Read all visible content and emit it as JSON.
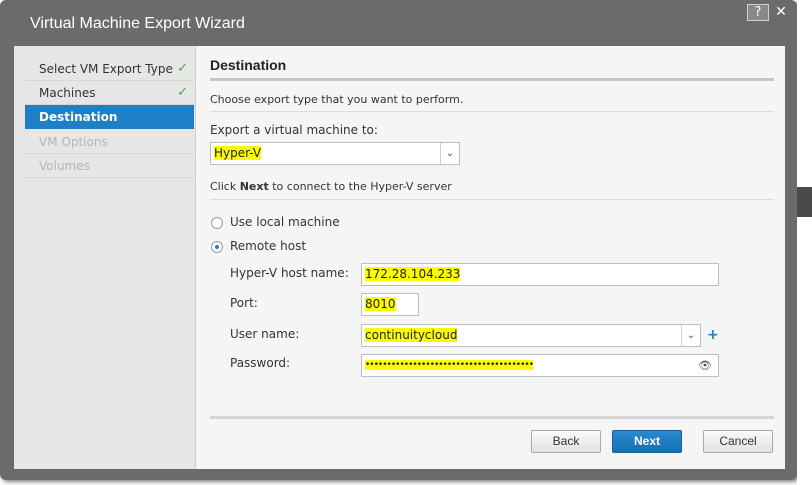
{
  "window": {
    "title": "Virtual Machine Export Wizard",
    "help_label": "?",
    "close_label": "✕"
  },
  "nav": {
    "items": [
      {
        "label": "Select VM Export Type",
        "state": "done"
      },
      {
        "label": "Machines",
        "state": "done"
      },
      {
        "label": "Destination",
        "state": "active"
      },
      {
        "label": "VM Options",
        "state": "disabled"
      },
      {
        "label": "Volumes",
        "state": "disabled"
      }
    ],
    "check_glyph": "✓"
  },
  "main": {
    "heading": "Destination",
    "instruction": "Choose export type that you want to perform.",
    "export_label": "Export a virtual machine to:",
    "export_value": "Hyper-V",
    "next_hint_prefix": "Click ",
    "next_hint_bold": "Next",
    "next_hint_suffix": " to connect to the Hyper-V server",
    "radio_local": "Use local machine",
    "radio_remote": "Remote host",
    "host_label": "Hyper-V host name:",
    "host_value": "172.28.104.233",
    "port_label": "Port:",
    "port_value": "8010",
    "user_label": "User name:",
    "user_value": "continuitycloud",
    "password_label": "Password:",
    "password_value": "•••••••••••••••••••••••••••••••••••••••",
    "selected_connection": "Remote host"
  },
  "buttons": {
    "back": "Back",
    "next": "Next",
    "cancel": "Cancel"
  },
  "colors": {
    "accent": "#1d7fc6",
    "highlight": "#fdfb00",
    "check": "#4aa34a"
  },
  "icons": {
    "dropdown": "chevron-down-icon",
    "reveal": "eye-icon",
    "add": "plus-icon"
  }
}
